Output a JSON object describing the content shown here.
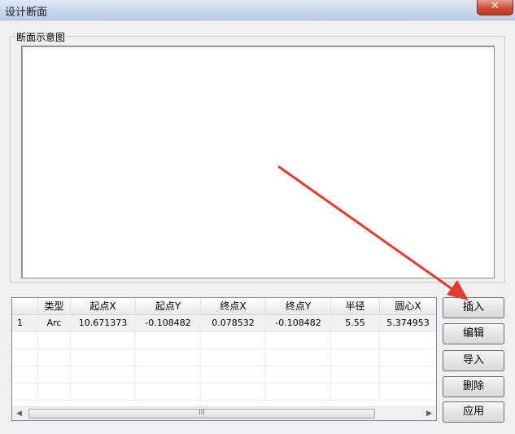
{
  "window": {
    "title": "设计断面",
    "close_glyph": "✕"
  },
  "group": {
    "label": "断面示意图"
  },
  "table": {
    "columns": [
      "",
      "类型",
      "起点X",
      "起点Y",
      "终点X",
      "终点Y",
      "半径",
      "圆心X"
    ],
    "rows": [
      [
        "1",
        "Arc",
        "10.671373",
        "-0.108482",
        "0.078532",
        "-0.108482",
        "5.55",
        "5.374953"
      ]
    ],
    "scrollbar_grip": "III",
    "scroll_left": "◀",
    "scroll_right": "▶"
  },
  "buttons": {
    "insert": "插入",
    "edit": "编辑",
    "import": "导入",
    "delete": "删除",
    "apply": "应用"
  },
  "annotation": {
    "arrow_color": "#e8392f"
  }
}
